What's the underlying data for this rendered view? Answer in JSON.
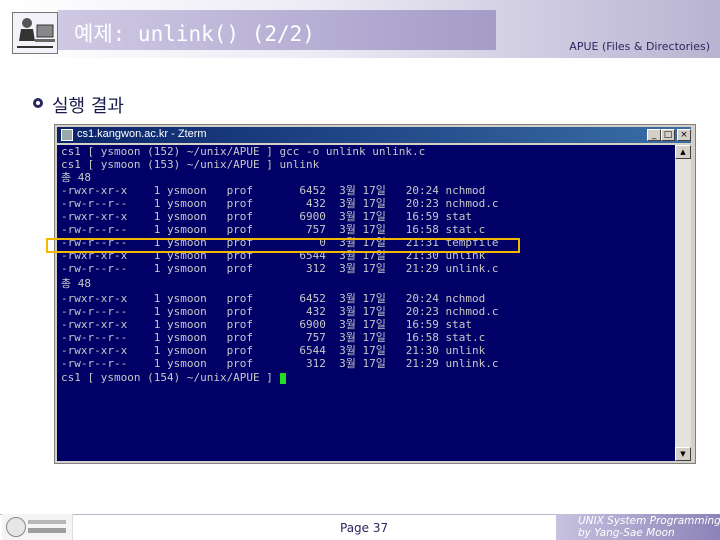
{
  "slide": {
    "title": "예제: unlink() (2/2)",
    "course": "APUE (Files & Directories)",
    "subtitle": "실행 결과",
    "page": "Page 37",
    "footer_line1": "UNIX System Programming",
    "footer_line2": "by Yang-Sae Moon"
  },
  "terminal": {
    "title": "cs1.kangwon.ac.kr - Zterm",
    "buttons": {
      "minimize": "_",
      "maximize": "□",
      "close": "×"
    },
    "lines": [
      "cs1 [ ysmoon (152) ~/unix/APUE ] gcc -o unlink unlink.c",
      "cs1 [ ysmoon (153) ~/unix/APUE ] unlink",
      "총 48",
      "-rwxr-xr-x    1 ysmoon   prof       6452  3월 17일   20:24 nchmod",
      "-rw-r--r--    1 ysmoon   prof        432  3월 17일   20:23 nchmod.c",
      "-rwxr-xr-x    1 ysmoon   prof       6900  3월 17일   16:59 stat",
      "-rw-r--r--    1 ysmoon   prof        757  3월 17일   16:58 stat.c",
      "-rw-r--r--    1 ysmoon   prof          0  3월 17일   21:31 tempfile",
      "-rwxr-xr-x    1 ysmoon   prof       6544  3월 17일   21:30 unlink",
      "-rw-r--r--    1 ysmoon   prof        312  3월 17일   21:29 unlink.c",
      "총 48",
      "-rwxr-xr-x    1 ysmoon   prof       6452  3월 17일   20:24 nchmod",
      "-rw-r--r--    1 ysmoon   prof        432  3월 17일   20:23 nchmod.c",
      "-rwxr-xr-x    1 ysmoon   prof       6900  3월 17일   16:59 stat",
      "-rw-r--r--    1 ysmoon   prof        757  3월 17일   16:58 stat.c",
      "-rwxr-xr-x    1 ysmoon   prof       6544  3월 17일   21:30 unlink",
      "-rw-r--r--    1 ysmoon   prof        312  3월 17일   21:29 unlink.c",
      "cs1 [ ysmoon (154) ~/unix/APUE ] "
    ]
  },
  "colors": {
    "terminal_bg": "#000066",
    "terminal_text": "#c8c8c8",
    "cursor": "#22dd22",
    "highlight": "#f2b800",
    "title_accent": "#a59cc8"
  },
  "icons": {
    "bullet": "bullet-icon",
    "title_logo": "person-computer-icon",
    "footer_logo": "university-logo"
  }
}
